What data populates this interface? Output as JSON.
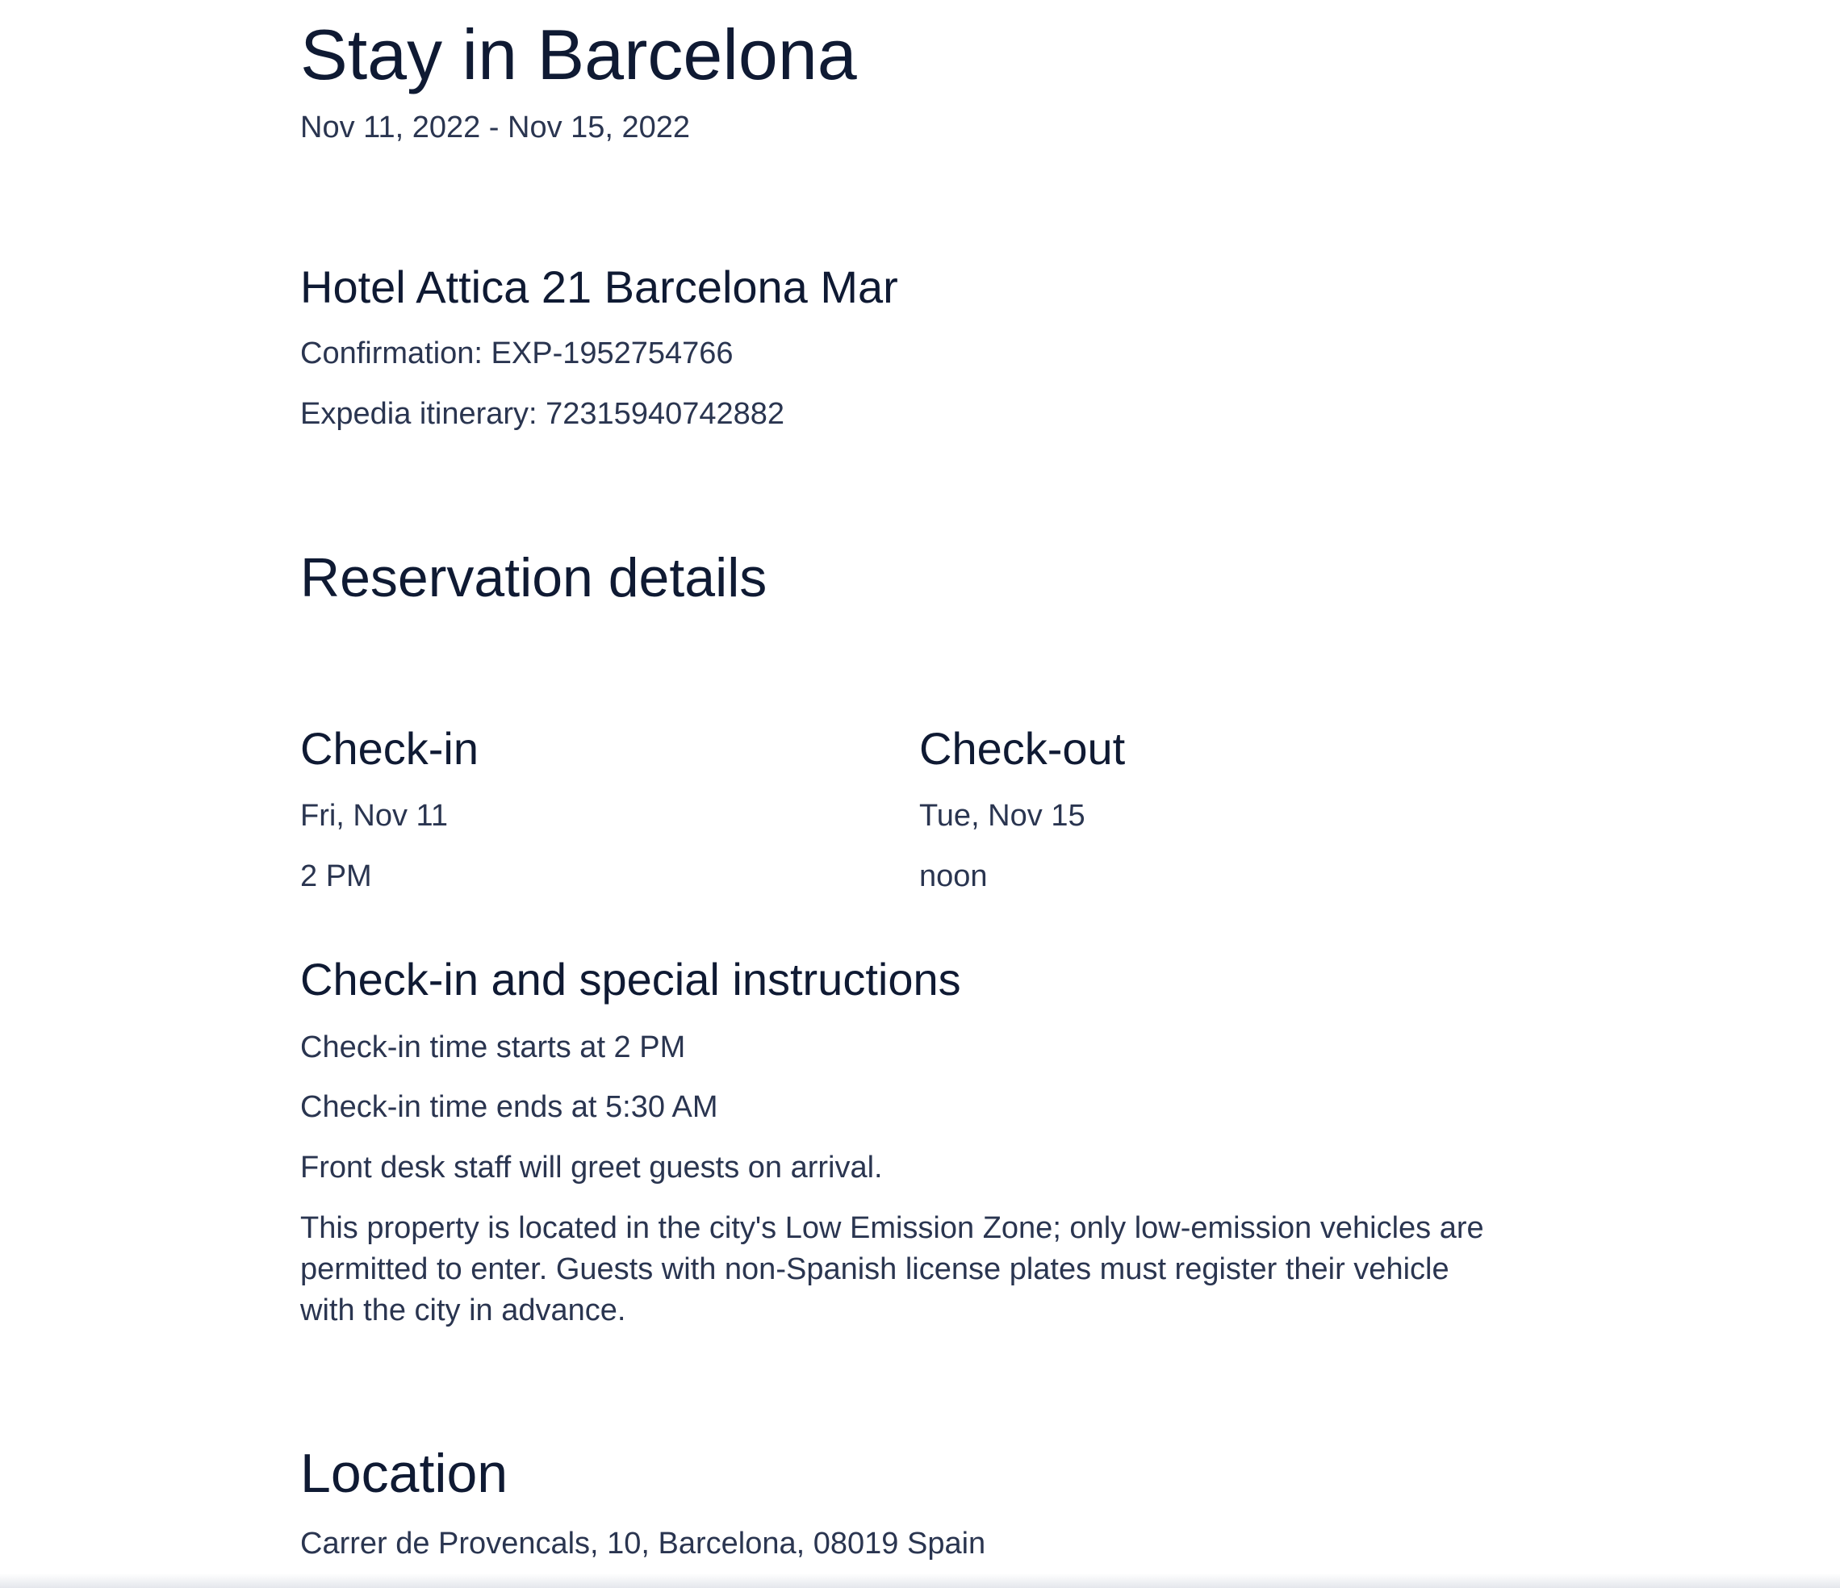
{
  "trip": {
    "title": "Stay in Barcelona",
    "dates": "Nov 11, 2022 - Nov 15, 2022"
  },
  "hotel": {
    "name": "Hotel Attica 21 Barcelona Mar",
    "confirmation": "Confirmation: EXP-1952754766",
    "itinerary": "Expedia itinerary: 72315940742882"
  },
  "reservation": {
    "title": "Reservation details",
    "checkin": {
      "title": "Check-in",
      "date": "Fri, Nov 11",
      "time": "2 PM"
    },
    "checkout": {
      "title": "Check-out",
      "date": "Tue, Nov 15",
      "time": "noon"
    },
    "instructions": {
      "title": "Check-in and special instructions",
      "items": [
        "Check-in time starts at 2 PM",
        "Check-in time ends at 5:30 AM",
        "Front desk staff will greet guests on arrival.",
        "This property is located in the city's Low Emission Zone; only low-emission vehicles are permitted to enter. Guests with non-Spanish license plates must register their vehicle with the city in advance."
      ]
    }
  },
  "location": {
    "title": "Location",
    "address": "Carrer de Provencals, 10, Barcelona, 08019 Spain"
  }
}
